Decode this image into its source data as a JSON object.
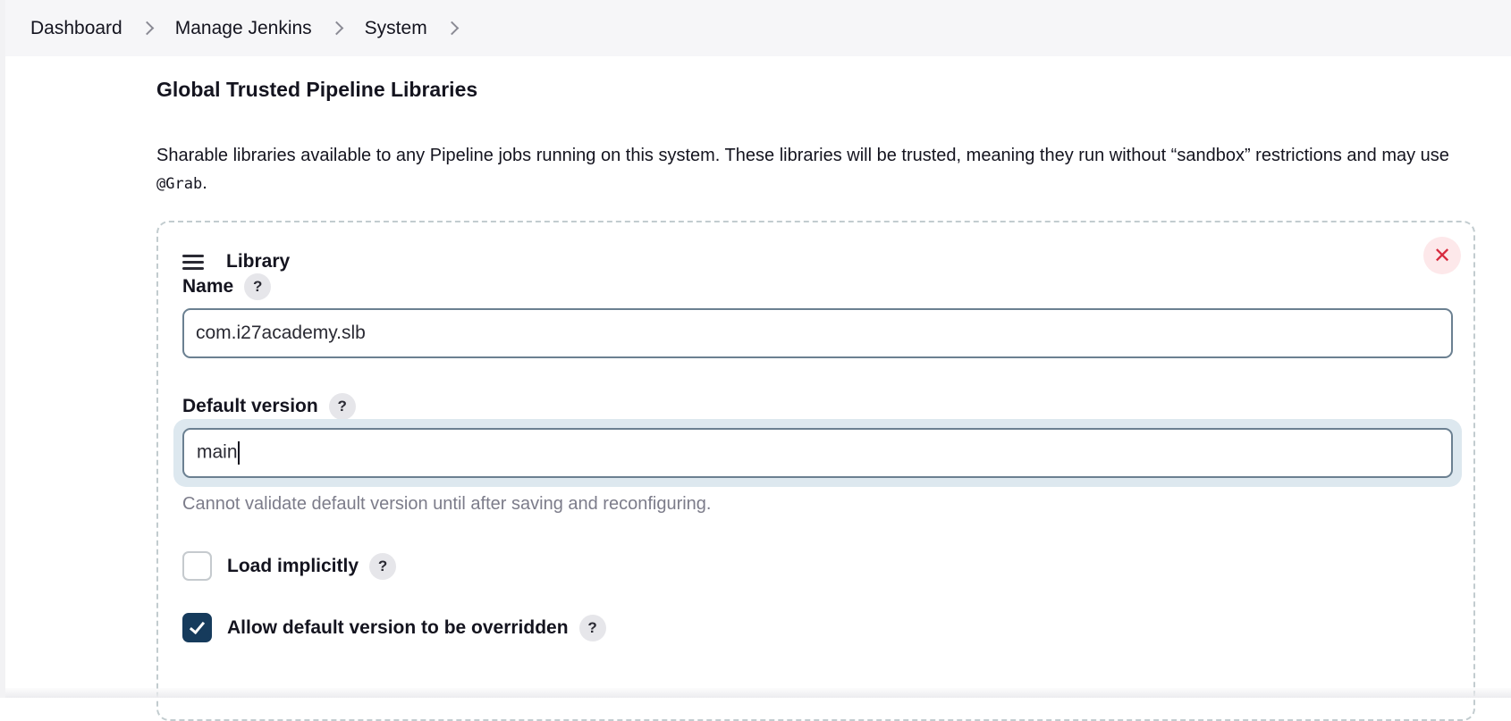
{
  "breadcrumb": {
    "items": [
      "Dashboard",
      "Manage Jenkins",
      "System"
    ]
  },
  "section": {
    "title": "Global Trusted Pipeline Libraries",
    "description_before": "Sharable libraries available to any Pipeline jobs running on this system. These libraries will be trusted, meaning they run without “sandbox” restrictions and may use ",
    "description_code": "@Grab",
    "description_after": "."
  },
  "library": {
    "title": "Library",
    "close_icon": "close-icon",
    "name_label": "Name",
    "name_value": "com.i27academy.slb",
    "default_version_label": "Default version",
    "default_version_value": "main",
    "default_version_hint": "Cannot validate default version until after saving and reconfiguring.",
    "load_implicitly_label": "Load implicitly",
    "load_implicitly_checked": false,
    "allow_override_label": "Allow default version to be overridden",
    "allow_override_checked": true,
    "help_glyph": "?"
  },
  "colors": {
    "accent": "#163b5c",
    "input_border": "#6b8091",
    "close_red": "#d72b3f"
  }
}
